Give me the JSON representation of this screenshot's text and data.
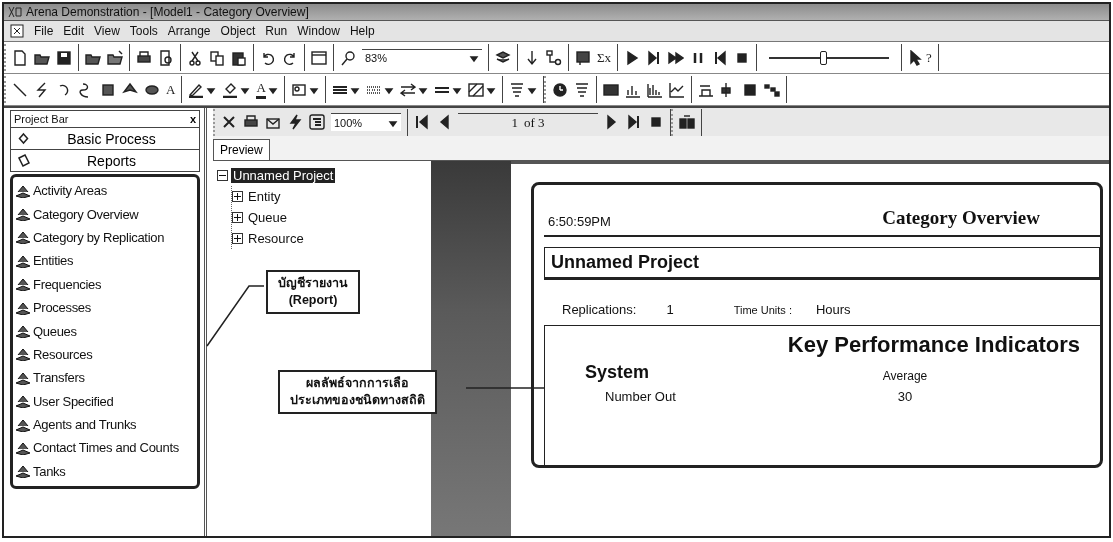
{
  "window": {
    "title": "Arena Demonstration - [Model1 - Category Overview]"
  },
  "menu": [
    "File",
    "Edit",
    "View",
    "Tools",
    "Arrange",
    "Object",
    "Run",
    "Window",
    "Help"
  ],
  "toolbar": {
    "zoom": "83%",
    "sum_glyph": "Σx",
    "speed_slider": {
      "level": 0.45
    },
    "help_glyph": "?"
  },
  "drawing_toolbar": {
    "text_glyph": "A",
    "font_color_glyph": "A"
  },
  "project_bar": {
    "title": "Project Bar",
    "close": "x",
    "panels": [
      "Basic Process",
      "Reports"
    ],
    "items": [
      "Activity Areas",
      "Category Overview",
      "Category by Replication",
      "Entities",
      "Frequencies",
      "Processes",
      "Queues",
      "Resources",
      "Transfers",
      "User Specified",
      "Agents and Trunks",
      "Contact Times and Counts",
      "Tanks"
    ]
  },
  "preview": {
    "zoom": "100%",
    "page": "1",
    "page_count": "of 3",
    "tab": "Preview",
    "tree": {
      "label": "Unnamed Project",
      "expanded": true,
      "selected": true,
      "children": [
        {
          "label": "Entity",
          "expanded": false,
          "selected": false
        },
        {
          "label": "Queue",
          "expanded": false,
          "selected": false
        },
        {
          "label": "Resource",
          "expanded": false,
          "selected": false
        }
      ]
    }
  },
  "report": {
    "time": "6:50:59PM",
    "title": "Category Overview",
    "project": "Unnamed Project",
    "replications_label": "Replications:",
    "replications": "1",
    "time_units_label": "Time Units :",
    "time_units": "Hours",
    "kpi_title": "Key Performance Indicators",
    "section": "System",
    "column": "Average",
    "rows": [
      {
        "label": "Number Out",
        "value": "30"
      }
    ]
  },
  "callouts": [
    {
      "lines": [
        "บัญชีรายงาน",
        "(Report)"
      ]
    },
    {
      "lines": [
        "ผลลัพธ์จากการเลือ",
        "ประเภทของชนิดทางสถิติ"
      ]
    }
  ]
}
